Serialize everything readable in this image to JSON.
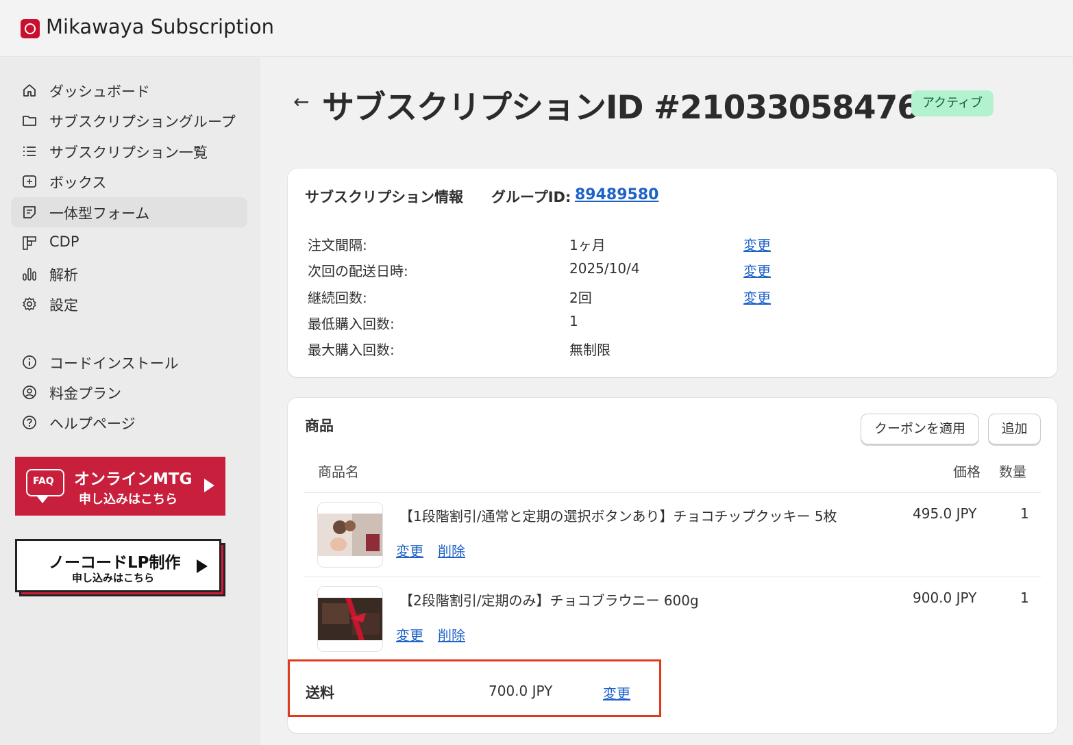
{
  "app": {
    "title": "Mikawaya Subscription"
  },
  "sidebar": {
    "items": [
      {
        "label": "ダッシュボード",
        "icon": "home-icon"
      },
      {
        "label": "サブスクリプショングループ",
        "icon": "folder-icon"
      },
      {
        "label": "サブスクリプション一覧",
        "icon": "list-icon"
      },
      {
        "label": "ボックス",
        "icon": "box-icon"
      },
      {
        "label": "一体型フォーム",
        "icon": "form-icon",
        "active": true
      },
      {
        "label": "CDP",
        "icon": "grid-icon"
      },
      {
        "label": "解析",
        "icon": "bar-chart-icon"
      },
      {
        "label": "設定",
        "icon": "gear-icon"
      },
      {
        "label": "コードインストール",
        "icon": "info-icon"
      },
      {
        "label": "料金プラン",
        "icon": "user-circle-icon"
      },
      {
        "label": "ヘルプページ",
        "icon": "help-icon"
      }
    ],
    "banners": {
      "mtg": {
        "badge": "FAQ",
        "title": "オンラインMTG",
        "sub": "申し込みはこちら",
        "color": "#c81f3c"
      },
      "lp": {
        "title": "ノーコードLP制作",
        "sub": "申し込みはこちら"
      }
    }
  },
  "header": {
    "title": "サブスクリプションID #21033058476",
    "status": "アクティブ"
  },
  "info": {
    "heading": "サブスクリプション情報",
    "group_label": "グループID:",
    "group_id": "89489580",
    "rows": [
      {
        "label": "注文間隔:",
        "value": "1ヶ月",
        "action": "変更"
      },
      {
        "label": "次回の配送日時:",
        "value": "2025/10/4",
        "action": "変更"
      },
      {
        "label": "継続回数:",
        "value": "2回",
        "action": "変更"
      },
      {
        "label": "最低購入回数:",
        "value": "1",
        "action": ""
      },
      {
        "label": "最大購入回数:",
        "value": "無制限",
        "action": ""
      }
    ]
  },
  "products": {
    "heading": "商品",
    "coupon_button": "クーポンを適用",
    "add_button": "追加",
    "columns": {
      "name": "商品名",
      "price": "価格",
      "qty": "数量"
    },
    "items": [
      {
        "name": "【1段階割引/通常と定期の選択ボタンあり】チョコチップクッキー 5枚",
        "price": "495.0 JPY",
        "qty": "1",
        "change": "変更",
        "delete": "削除"
      },
      {
        "name": "【2段階割引/定期のみ】チョコブラウニー 600g",
        "price": "900.0 JPY",
        "qty": "1",
        "change": "変更",
        "delete": "削除"
      }
    ],
    "shipping": {
      "label": "送料",
      "value": "700.0 JPY",
      "action": "変更"
    }
  },
  "colors": {
    "accent_link": "#1d62c9",
    "status_bg": "#b3f2cf",
    "highlight_border": "#e03a1e",
    "brand_red": "#c81f3c"
  }
}
